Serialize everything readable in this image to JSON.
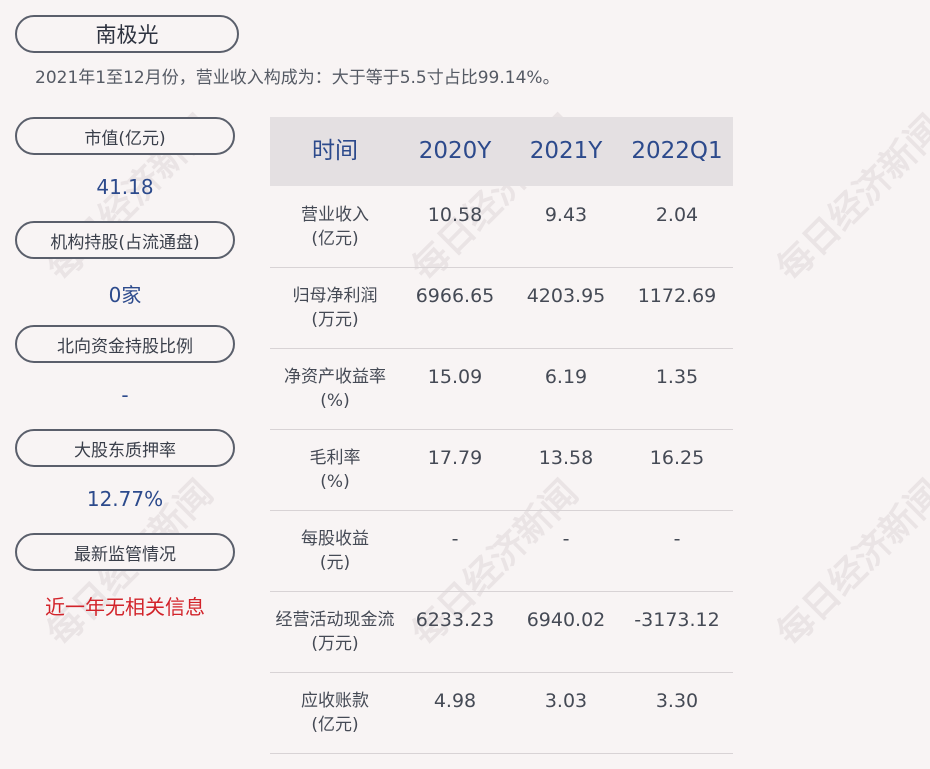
{
  "company": "南极光",
  "subtitle": "2021年1至12月份，营业收入构成为：大于等于5.5寸占比99.14%。",
  "left_panel": [
    {
      "label": "市值(亿元)",
      "value": "41.18",
      "highlight": false
    },
    {
      "label": "机构持股(占流通盘)",
      "value": "0家",
      "highlight": false
    },
    {
      "label": "北向资金持股比例",
      "value": "-",
      "highlight": false
    },
    {
      "label": "大股东质押率",
      "value": "12.77%",
      "highlight": false
    },
    {
      "label": "最新监管情况",
      "value": "近一年无相关信息",
      "highlight": true
    }
  ],
  "table": {
    "headers": [
      "时间",
      "2020Y",
      "2021Y",
      "2022Q1"
    ],
    "rows": [
      {
        "label1": "营业收入",
        "label2": "(亿元)",
        "values": [
          "10.58",
          "9.43",
          "2.04"
        ]
      },
      {
        "label1": "归母净利润",
        "label2": "(万元)",
        "values": [
          "6966.65",
          "4203.95",
          "1172.69"
        ]
      },
      {
        "label1": "净资产收益率",
        "label2": "(%)",
        "values": [
          "15.09",
          "6.19",
          "1.35"
        ]
      },
      {
        "label1": "毛利率",
        "label2": "(%)",
        "values": [
          "17.79",
          "13.58",
          "16.25"
        ]
      },
      {
        "label1": "每股收益",
        "label2": "(元)",
        "values": [
          "-",
          "-",
          "-"
        ]
      },
      {
        "label1": "经营活动现金流",
        "label2": "(万元)",
        "values": [
          "6233.23",
          "6940.02",
          "-3173.12"
        ]
      },
      {
        "label1": "应收账款",
        "label2": "(亿元)",
        "values": [
          "4.98",
          "3.03",
          "3.30"
        ]
      }
    ]
  },
  "watermark": "每日经济新闻",
  "colors": {
    "accent": "#2c4a8c",
    "alert": "#d2232a",
    "header_bg": "#e4e0e2",
    "background": "#f8f4f4"
  }
}
